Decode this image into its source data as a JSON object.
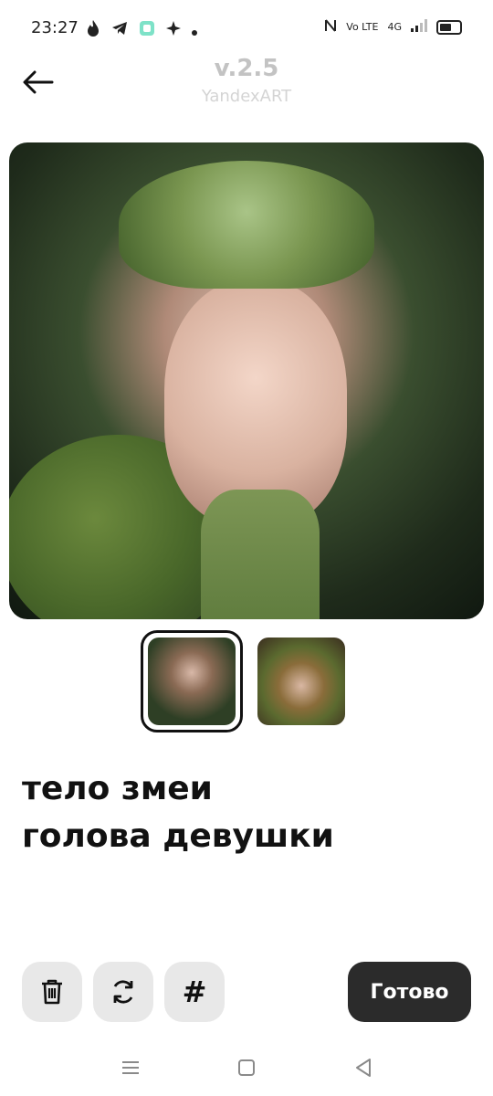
{
  "status_bar": {
    "time": "23:27",
    "network_label": "4G",
    "volte_label": "Vo LTE"
  },
  "header": {
    "title": "v.2.5",
    "subtitle": "YandexART"
  },
  "prompt": {
    "line1": "тело змеи",
    "line2": "голова девушки"
  },
  "actions": {
    "delete_icon": "trash-icon",
    "regenerate_icon": "refresh-icon",
    "hashtag_label": "#",
    "done_label": "Готово"
  },
  "colors": {
    "done_button": "#2b2b2b",
    "action_button_bg": "#e8e8e8",
    "title_text": "#c3c3c3"
  }
}
